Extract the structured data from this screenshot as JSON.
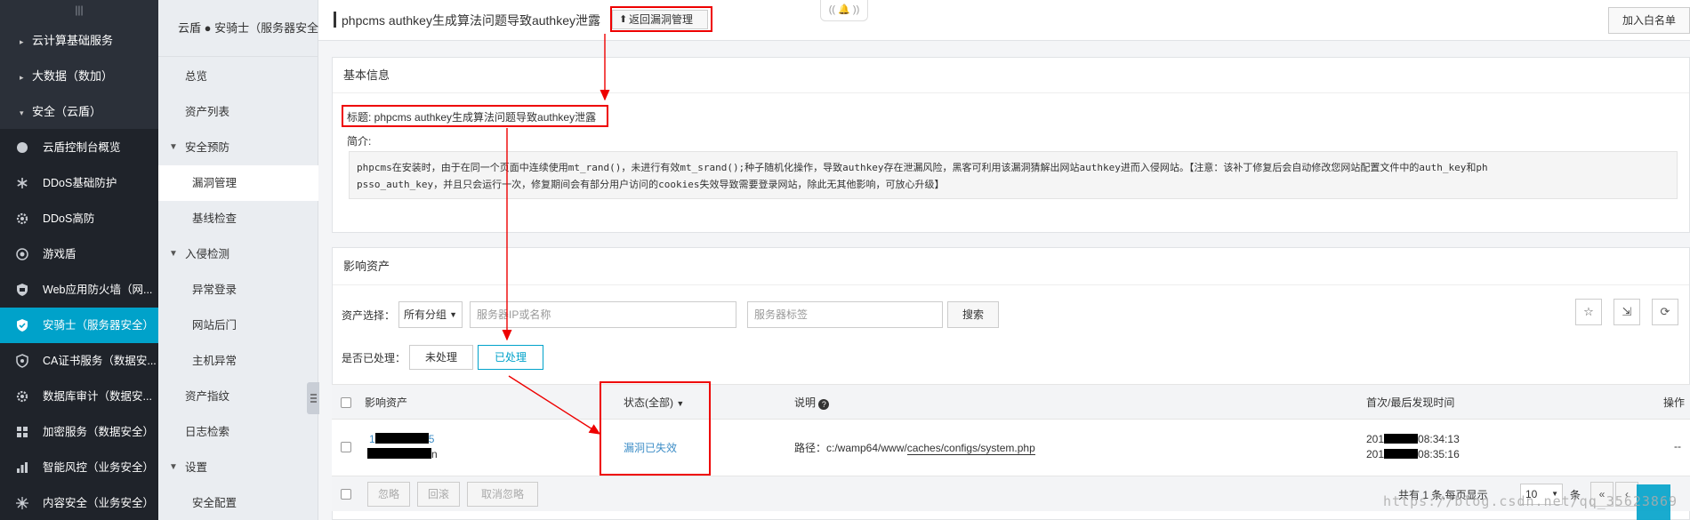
{
  "sidebar": {
    "grip": "|||",
    "groups": [
      {
        "label": "云计算基础服务",
        "caret": "▸"
      },
      {
        "label": "大数据（数加）",
        "caret": "▸"
      },
      {
        "label": "安全（云盾）",
        "caret": "▾"
      }
    ],
    "items": [
      {
        "label": "云盾控制台概览",
        "icon": "circle-icon"
      },
      {
        "label": "DDoS基础防护",
        "icon": "snowflake-icon"
      },
      {
        "label": "DDoS高防",
        "icon": "gear-icon"
      },
      {
        "label": "游戏盾",
        "icon": "eye-icon"
      },
      {
        "label": "Web应用防火墙（网...",
        "icon": "shield-icon"
      },
      {
        "label": "安骑士（服务器安全）",
        "icon": "shield-icon"
      },
      {
        "label": "CA证书服务（数据安...",
        "icon": "shield-icon"
      },
      {
        "label": "数据库审计（数据安...",
        "icon": "gear-icon"
      },
      {
        "label": "加密服务（数据安全）",
        "icon": "grid-icon"
      },
      {
        "label": "智能风控（业务安全）",
        "icon": "chart-icon"
      },
      {
        "label": "内容安全（业务安全）",
        "icon": "network-icon"
      }
    ]
  },
  "subnav": {
    "header": "云盾 ● 安骑士（服务器安全）",
    "items": [
      {
        "label": "总览"
      },
      {
        "label": "资产列表"
      },
      {
        "label": "安全预防"
      },
      {
        "label": "漏洞管理"
      },
      {
        "label": "基线检查"
      },
      {
        "label": "入侵检测"
      },
      {
        "label": "异常登录"
      },
      {
        "label": "网站后门"
      },
      {
        "label": "主机异常"
      },
      {
        "label": "资产指纹"
      },
      {
        "label": "日志检索"
      },
      {
        "label": "设置"
      },
      {
        "label": "安全配置"
      }
    ]
  },
  "header": {
    "title": "phpcms authkey生成算法问题导致authkey泄露",
    "back_label": "返回漏洞管理",
    "bell": "((  🔔  ))",
    "whitelist": "加入白名单"
  },
  "basic": {
    "heading": "基本信息",
    "title_line": "标题: phpcms authkey生成算法问题导致authkey泄露",
    "intro_label": "简介:",
    "desc_line1": "phpcms在安装时，由于在同一个页面中连续使用mt_rand()，未进行有效mt_srand();种子随机化操作，导致authkey存在泄漏风险，黑客可利用该漏洞猜解出网站authkey进而入侵网站。【注意：该补丁修复后会自动修改您网站配置文件中的auth_key和ph",
    "desc_line2": "psso_auth_key，并且只会运行一次，修复期间会有部分用户访问的cookies失效导致需要登录网站，除此无其他影响，可放心升级】"
  },
  "assets": {
    "heading": "影响资产",
    "filter_label": "资产选择：",
    "group_select": "所有分组",
    "search_placeholder": "服务器IP或名称",
    "tag_placeholder": "服务器标签",
    "search_btn": "搜索",
    "handled_label": "是否已处理：",
    "tab_unhandled": "未处理",
    "tab_handled": "已处理",
    "columns": {
      "asset": "影响资产",
      "status": "状态(全部)",
      "note": "说明",
      "time": "首次/最后发现时间",
      "op": "操作"
    },
    "row": {
      "asset_ip_prefix": "1",
      "asset_ip_suffix": "5",
      "asset_name_suffix": "n",
      "status": "漏洞已失效",
      "note_prefix": "路径：c:/wamp64/www/",
      "note_path": "caches/configs/system.php",
      "time1_prefix": "201",
      "time1_suffix": "08:34:13",
      "time2_prefix": "201",
      "time2_suffix": "08:35:16",
      "op": "--"
    },
    "footer": {
      "ignore": "忽略",
      "rollback": "回滚",
      "cancel_ignore": "取消忽略",
      "total": "共有 1 条,每页显示",
      "page_size": "10",
      "unit": "条",
      "prev": "«",
      "next": "‹"
    }
  },
  "watermark": "https://blog.csdn.net/qq_35623869",
  "colors": {
    "accent": "#00a2ca",
    "sidebar": "#2b3039",
    "annotation": "#e00000"
  }
}
